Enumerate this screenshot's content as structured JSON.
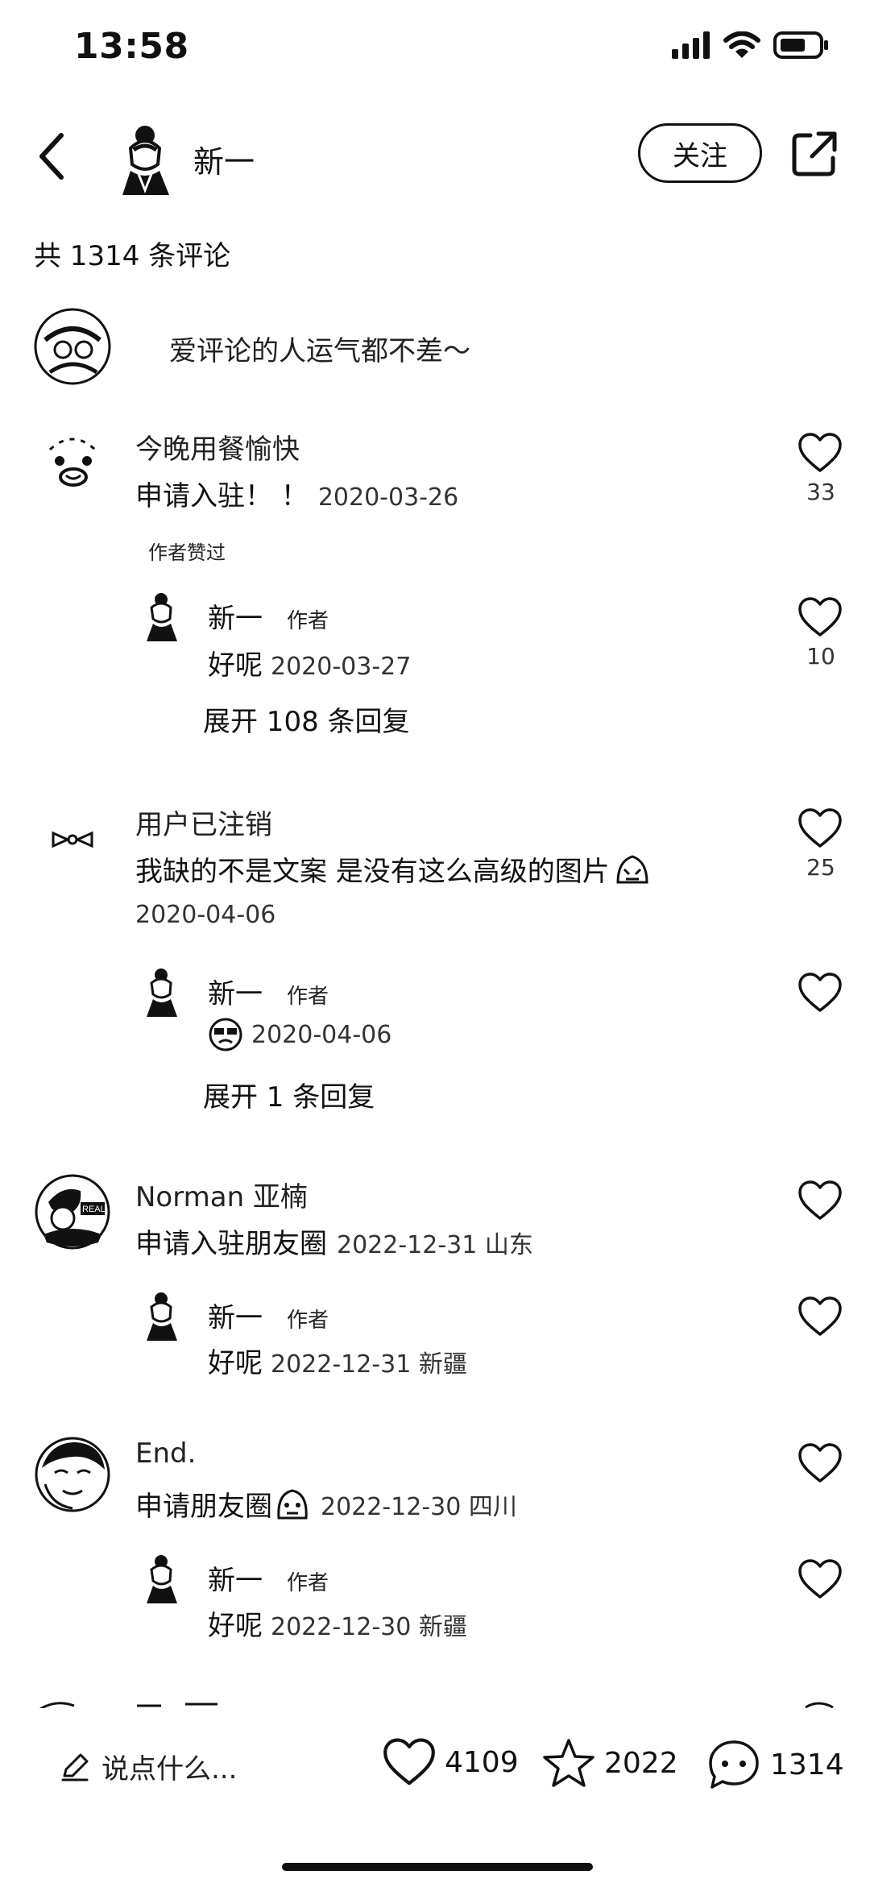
{
  "status": {
    "time": "13:58"
  },
  "header": {
    "author_name": "新一",
    "follow_label": "关注"
  },
  "total_comments_label": "共 1314 条评论",
  "prompt_text": "爱评论的人运气都不差～",
  "comments": [
    {
      "name": "今晚用餐愉快",
      "text": "申请入驻！ ！",
      "date": "2020-03-26",
      "likes": "33",
      "badge": "作者赞过",
      "reply": {
        "name": "新一",
        "tag": "作者",
        "text": "好呢",
        "date": "2020-03-27",
        "likes": "10"
      },
      "expand": "展开 108 条回复"
    },
    {
      "name": "用户已注销",
      "text": "我缺的不是文案 是没有这么高级的图片",
      "date": "2020-04-06",
      "likes": "25",
      "reply": {
        "name": "新一",
        "tag": "作者",
        "text": "",
        "date": "2020-04-06"
      },
      "expand": "展开 1 条回复"
    },
    {
      "name": "Norman 亚楠",
      "text": "申请入驻朋友圈",
      "date": "2022-12-31 山东",
      "reply": {
        "name": "新一",
        "tag": "作者",
        "text": "好呢",
        "date": "2022-12-31 新疆"
      }
    },
    {
      "name": "End.",
      "text": "申请朋友圈",
      "date": "2022-12-30 四川",
      "reply": {
        "name": "新一",
        "tag": "作者",
        "text": "好呢",
        "date": "2022-12-30 新疆"
      }
    }
  ],
  "bottom": {
    "placeholder": "说点什么...",
    "likes": "4109",
    "stars": "2022",
    "comments": "1314"
  },
  "icons": [
    "back-icon",
    "share-icon",
    "heart-icon",
    "star-icon",
    "comment-icon",
    "pencil-icon"
  ]
}
